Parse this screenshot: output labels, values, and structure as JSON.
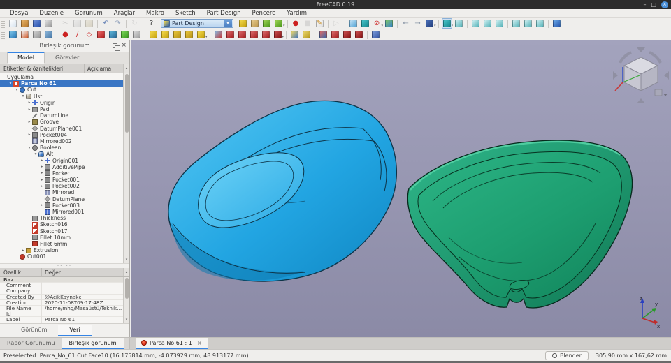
{
  "window": {
    "title": "FreeCAD 0.19"
  },
  "ui": {
    "caret": "▾",
    "exp_open": "▾",
    "exp_closed": "▸",
    "close": "×",
    "minimize": "–",
    "maximize": "□",
    "scroll_up": "▴",
    "scroll_down": "▾",
    "scroll_left": "◂",
    "scroll_right": "▸",
    "splitter_dots": "·····"
  },
  "menu_bar": {
    "items": [
      "Dosya",
      "Düzenle",
      "Görünüm",
      "Araçlar",
      "Makro",
      "Sketch",
      "Part Design",
      "Pencere",
      "Yardım"
    ]
  },
  "toolbar": {
    "workbench": "Part Design",
    "row1": [
      {
        "t": "g"
      },
      {
        "n": "new-file",
        "c": [
          "#ffffff",
          "#d8e4f0"
        ]
      },
      {
        "n": "open-file",
        "c": [
          "#e8b366",
          "#b97a2e"
        ]
      },
      {
        "n": "save-file",
        "c": [
          "#6f8fd8",
          "#2b55b0"
        ]
      },
      {
        "n": "print",
        "c": [
          "#e0e0e0",
          "#9a9a9a"
        ]
      },
      {
        "t": "s"
      },
      {
        "n": "cut",
        "g": "✂",
        "fg": "#b0b0b0",
        "d": true
      },
      {
        "n": "copy",
        "c": [
          "#e6e6e6",
          "#c6c6c6"
        ],
        "d": true
      },
      {
        "n": "paste",
        "c": [
          "#e2dbc8",
          "#c0b79e"
        ],
        "d": true
      },
      {
        "t": "s"
      },
      {
        "n": "undo",
        "g": "↶",
        "fg": "#6b86b8"
      },
      {
        "n": "redo",
        "g": "↷",
        "fg": "#9aa8c0"
      },
      {
        "t": "s"
      },
      {
        "n": "refresh",
        "g": "↻",
        "fg": "#bcbcbc",
        "d": true
      },
      {
        "t": "s"
      },
      {
        "n": "whats-this",
        "g": "?",
        "fg": "#444444"
      },
      {
        "t": "combo"
      },
      {
        "n": "std-part",
        "c": [
          "#f2d84a",
          "#c8a40f"
        ]
      },
      {
        "n": "std-group",
        "c": [
          "#e6c98a",
          "#bf9a50"
        ]
      },
      {
        "n": "make-link",
        "c": [
          "#9ed454",
          "#4f9a1e"
        ]
      },
      {
        "n": "make-link-group",
        "c": [
          "#9ed454",
          "#4f9a1e"
        ],
        "caret": true
      },
      {
        "t": "s"
      },
      {
        "n": "macro-record",
        "g": "●",
        "fg": "#cc2020"
      },
      {
        "n": "macro-stop",
        "g": "■",
        "fg": "#c0c0c0",
        "d": true
      },
      {
        "n": "macro-edit",
        "c": [
          "#fafafa",
          "#e0e0e0"
        ],
        "g": "✎",
        "fg": "#c98a1a"
      },
      {
        "t": "s"
      },
      {
        "n": "macro-play",
        "g": "▷",
        "fg": "#c0c0c0",
        "d": true
      },
      {
        "t": "s"
      },
      {
        "n": "fit-all",
        "c": [
          "#bfe0f4",
          "#58a6d6"
        ]
      },
      {
        "n": "zoom-tool",
        "c": [
          "#49c2c8",
          "#178a90"
        ]
      },
      {
        "n": "clipping-plane",
        "g": "⊘",
        "fg": "#cc2222",
        "caret": true
      },
      {
        "n": "texture-view",
        "c": [
          "#7ec46a",
          "#3a86c8"
        ]
      },
      {
        "t": "s"
      },
      {
        "n": "nav-back",
        "g": "←",
        "fg": "#8c98a8"
      },
      {
        "n": "nav-forward",
        "g": "→",
        "fg": "#8c98a8"
      },
      {
        "n": "view-rotate",
        "c": [
          "#4a6fb8",
          "#24407e"
        ],
        "caret": true
      },
      {
        "t": "s"
      },
      {
        "n": "zoom-region",
        "c": [
          "#49c2c8",
          "#178a90"
        ],
        "a": true,
        "caret": true
      },
      {
        "n": "view-axonometric",
        "c": [
          "#cdeef0",
          "#5ab4ba"
        ]
      },
      {
        "t": "s"
      },
      {
        "n": "view-front",
        "c": [
          "#cdeef0",
          "#5ab4ba"
        ]
      },
      {
        "n": "view-top",
        "c": [
          "#cdeef0",
          "#5ab4ba"
        ]
      },
      {
        "n": "view-right",
        "c": [
          "#cdeef0",
          "#5ab4ba"
        ]
      },
      {
        "t": "s"
      },
      {
        "n": "view-rear",
        "c": [
          "#cdeef0",
          "#5ab4ba"
        ]
      },
      {
        "n": "view-bottom",
        "c": [
          "#cdeef0",
          "#5ab4ba"
        ]
      },
      {
        "n": "view-left",
        "c": [
          "#cdeef0",
          "#5ab4ba"
        ]
      },
      {
        "t": "s"
      },
      {
        "n": "measure-distance",
        "c": [
          "#6aa8e8",
          "#2a5ab0"
        ]
      }
    ],
    "row2": [
      {
        "t": "g"
      },
      {
        "n": "create-body",
        "c": [
          "#7ac4e8",
          "#2a7ab8"
        ]
      },
      {
        "n": "create-sketch",
        "c": [
          "#f0f0f0",
          "#d05a2a"
        ]
      },
      {
        "n": "map-sketch",
        "c": [
          "#cfcfcf",
          "#9a9a9a"
        ]
      },
      {
        "n": "edit-sketch",
        "c": [
          "#8ab4d8",
          "#4a7aa8"
        ]
      },
      {
        "t": "s"
      },
      {
        "n": "datum-point",
        "g": "●",
        "fg": "#cc2222"
      },
      {
        "n": "datum-line",
        "g": "/",
        "fg": "#cc2222"
      },
      {
        "n": "datum-plane",
        "g": "◇",
        "fg": "#cc2222"
      },
      {
        "n": "local-coordinate-system",
        "c": [
          "#e86a6a",
          "#b02020"
        ]
      },
      {
        "n": "shape-binder",
        "c": [
          "#5ab4d8",
          "#2a6a98"
        ]
      },
      {
        "n": "clone",
        "c": [
          "#7ad45a",
          "#3a9a1e"
        ]
      },
      {
        "n": "sub-shape-binder",
        "c": [
          "#d8d8d8",
          "#a0a0a0"
        ]
      },
      {
        "t": "s"
      },
      {
        "n": "pad",
        "c": [
          "#f2d84a",
          "#c8a40f"
        ]
      },
      {
        "n": "revolution",
        "c": [
          "#f2d84a",
          "#c8a40f"
        ]
      },
      {
        "n": "additive-loft",
        "c": [
          "#e8c43a",
          "#b8941a"
        ]
      },
      {
        "n": "additive-pipe",
        "c": [
          "#e8c43a",
          "#b8941a"
        ]
      },
      {
        "n": "additive-primitive",
        "c": [
          "#f2d84a",
          "#c8a40f"
        ],
        "caret": true
      },
      {
        "t": "s"
      },
      {
        "n": "pocket",
        "c": [
          "#8ab4d8",
          "#c04040"
        ]
      },
      {
        "n": "hole",
        "c": [
          "#d86a6a",
          "#a82020"
        ]
      },
      {
        "n": "groove",
        "c": [
          "#d86a6a",
          "#a82020"
        ]
      },
      {
        "n": "subtractive-loft",
        "c": [
          "#d86a6a",
          "#a82020"
        ]
      },
      {
        "n": "subtractive-pipe",
        "c": [
          "#d86a6a",
          "#a82020"
        ]
      },
      {
        "n": "subtractive-primitive",
        "c": [
          "#c85050",
          "#8a1515"
        ],
        "caret": true
      },
      {
        "t": "s"
      },
      {
        "n": "mirrored-transform",
        "c": [
          "#e8d46a",
          "#4a7ab8"
        ]
      },
      {
        "n": "multi-transform",
        "c": [
          "#e8d46a",
          "#b89a20"
        ]
      },
      {
        "t": "s"
      },
      {
        "n": "fillet",
        "c": [
          "#d86a6a",
          "#3a66a8"
        ]
      },
      {
        "n": "chamfer",
        "c": [
          "#d86a6a",
          "#a82020"
        ]
      },
      {
        "n": "draft",
        "c": [
          "#c85050",
          "#8a1515"
        ]
      },
      {
        "n": "thickness",
        "c": [
          "#c85050",
          "#8a1515"
        ]
      },
      {
        "t": "s"
      },
      {
        "n": "boolean-operation",
        "c": [
          "#7a9ad8",
          "#3a5aa8"
        ]
      }
    ]
  },
  "left_panel": {
    "title": "Birleşik görünüm",
    "tabs": [
      {
        "label": "Model",
        "active": true
      },
      {
        "label": "Görevler",
        "active": false
      }
    ],
    "tree_header": {
      "col1": "Etiketler & öznitelikleri",
      "col2": "Açıklama"
    },
    "tree": [
      {
        "label": "Uygulama",
        "depth": 0,
        "exp": "none"
      },
      {
        "label": "Parca No 61",
        "depth": 1,
        "exp": "open",
        "selected": true,
        "icon": {
          "shape": "doc",
          "color": "#d8452a"
        }
      },
      {
        "label": "Cut",
        "depth": 2,
        "exp": "open",
        "icon": {
          "shape": "circle",
          "color": "#3a76c4"
        }
      },
      {
        "label": "Üst",
        "depth": 3,
        "exp": "open",
        "icon": {
          "shape": "body",
          "color": "#b0a894"
        }
      },
      {
        "label": "Origin",
        "depth": 4,
        "exp": "closed",
        "icon": {
          "shape": "axes",
          "color": "#4a6fd0"
        }
      },
      {
        "label": "Pad",
        "depth": 4,
        "exp": "closed",
        "icon": {
          "shape": "pad",
          "color": "#9a9a9a"
        }
      },
      {
        "label": "DatumLine",
        "depth": 4,
        "exp": "none",
        "icon": {
          "shape": "line",
          "color": "#777777"
        }
      },
      {
        "label": "Groove",
        "depth": 4,
        "exp": "closed",
        "icon": {
          "shape": "pad",
          "color": "#9a8a4a"
        }
      },
      {
        "label": "DatumPlane001",
        "depth": 4,
        "exp": "none",
        "icon": {
          "shape": "diamond",
          "color": "#aaaaaa"
        }
      },
      {
        "label": "Pocket004",
        "depth": 4,
        "exp": "closed",
        "icon": {
          "shape": "pad",
          "color": "#8a8a8a"
        }
      },
      {
        "label": "Mirrored002",
        "depth": 4,
        "exp": "none",
        "icon": {
          "shape": "mirror",
          "color": "#8a93b8"
        }
      },
      {
        "label": "Boolean",
        "depth": 4,
        "exp": "open",
        "icon": {
          "shape": "circle",
          "color": "#8a8a8a"
        }
      },
      {
        "label": "Alt",
        "depth": 5,
        "exp": "open",
        "icon": {
          "shape": "body",
          "color": "#3a76c4"
        }
      },
      {
        "label": "Origin001",
        "depth": 6,
        "exp": "closed",
        "icon": {
          "shape": "axes",
          "color": "#4a6fd0"
        }
      },
      {
        "label": "AdditivePipe",
        "depth": 6,
        "exp": "closed",
        "icon": {
          "shape": "pad",
          "color": "#9a9a9a"
        }
      },
      {
        "label": "Pocket",
        "depth": 6,
        "exp": "closed",
        "icon": {
          "shape": "pad",
          "color": "#8a8a8a"
        }
      },
      {
        "label": "Pocket001",
        "depth": 6,
        "exp": "closed",
        "icon": {
          "shape": "pad",
          "color": "#8a8a8a"
        }
      },
      {
        "label": "Pocket002",
        "depth": 6,
        "exp": "closed",
        "icon": {
          "shape": "pad",
          "color": "#8a8a8a"
        }
      },
      {
        "label": "Mirrored",
        "depth": 6,
        "exp": "none",
        "icon": {
          "shape": "mirror",
          "color": "#8a93b8"
        }
      },
      {
        "label": "DatumPlane",
        "depth": 6,
        "exp": "none",
        "icon": {
          "shape": "diamond",
          "color": "#aaaaaa"
        }
      },
      {
        "label": "Pocket003",
        "depth": 6,
        "exp": "closed",
        "icon": {
          "shape": "pad",
          "color": "#8a8a8a"
        }
      },
      {
        "label": "Mirrored001",
        "depth": 6,
        "exp": "none",
        "icon": {
          "shape": "mirror",
          "color": "#4a6fd0"
        }
      },
      {
        "label": "Thickness",
        "depth": 4,
        "exp": "none",
        "icon": {
          "shape": "pad",
          "color": "#9a9a9a"
        }
      },
      {
        "label": "Sketch016",
        "depth": 4,
        "exp": "none",
        "icon": {
          "shape": "sketch",
          "color": "#c43a2a"
        }
      },
      {
        "label": "Sketch017",
        "depth": 4,
        "exp": "none",
        "icon": {
          "shape": "sketch",
          "color": "#c43a2a"
        }
      },
      {
        "label": "Fillet 10mm",
        "depth": 4,
        "exp": "none",
        "icon": {
          "shape": "pad",
          "color": "#9a9a9a"
        }
      },
      {
        "label": "Fillet 6mm",
        "depth": 4,
        "exp": "none",
        "icon": {
          "shape": "pad",
          "color": "#c43a2a"
        }
      },
      {
        "label": "Extrusion",
        "depth": 3,
        "exp": "closed",
        "icon": {
          "shape": "pad",
          "color": "#caa23a"
        }
      },
      {
        "label": "Cut001",
        "depth": 2,
        "exp": "none",
        "icon": {
          "shape": "circle",
          "color": "#c43a2a"
        }
      }
    ],
    "properties": {
      "header": {
        "col1": "Özellik",
        "col2": "Değer"
      },
      "rows": [
        {
          "name": "Baz",
          "value": "",
          "group": true
        },
        {
          "name": "Comment",
          "value": ""
        },
        {
          "name": "Company",
          "value": ""
        },
        {
          "name": "Created By",
          "value": "@AcikKaynakci"
        },
        {
          "name": "Creation ...",
          "value": "2020-11-08T09:17:48Z"
        },
        {
          "name": "File Name",
          "value": "/home/mhg/Masaüstü/Teknik Çizimler..."
        },
        {
          "name": "Id",
          "value": ""
        },
        {
          "name": "Label",
          "value": "Parca No 61"
        }
      ]
    },
    "bottom_tabs": [
      {
        "label": "Görünüm",
        "active": false
      },
      {
        "label": "Veri",
        "active": true
      }
    ]
  },
  "dock_tabs": [
    {
      "label": "Rapor Görünümü",
      "active": false
    },
    {
      "label": "Birleşik görünüm",
      "active": true
    }
  ],
  "mdi_tab": {
    "label": "Parca No 61 : 1"
  },
  "status_bar": {
    "preselected": "Preselected: Parca_No_61.Cut.Face10 (16.175814 mm, -4.073929 mm, 48.913177 mm)",
    "nav_style": "Blender",
    "dimensions": "305,90 mm x 167,62 mm"
  },
  "viewport": {
    "objects": [
      {
        "name": "solid-part-blue",
        "color": "#1ca3e0"
      },
      {
        "name": "hollow-shell-part-green",
        "color": "#21a678"
      }
    ],
    "axis_labels": {
      "x": "x",
      "y": "y",
      "z": "z"
    }
  }
}
